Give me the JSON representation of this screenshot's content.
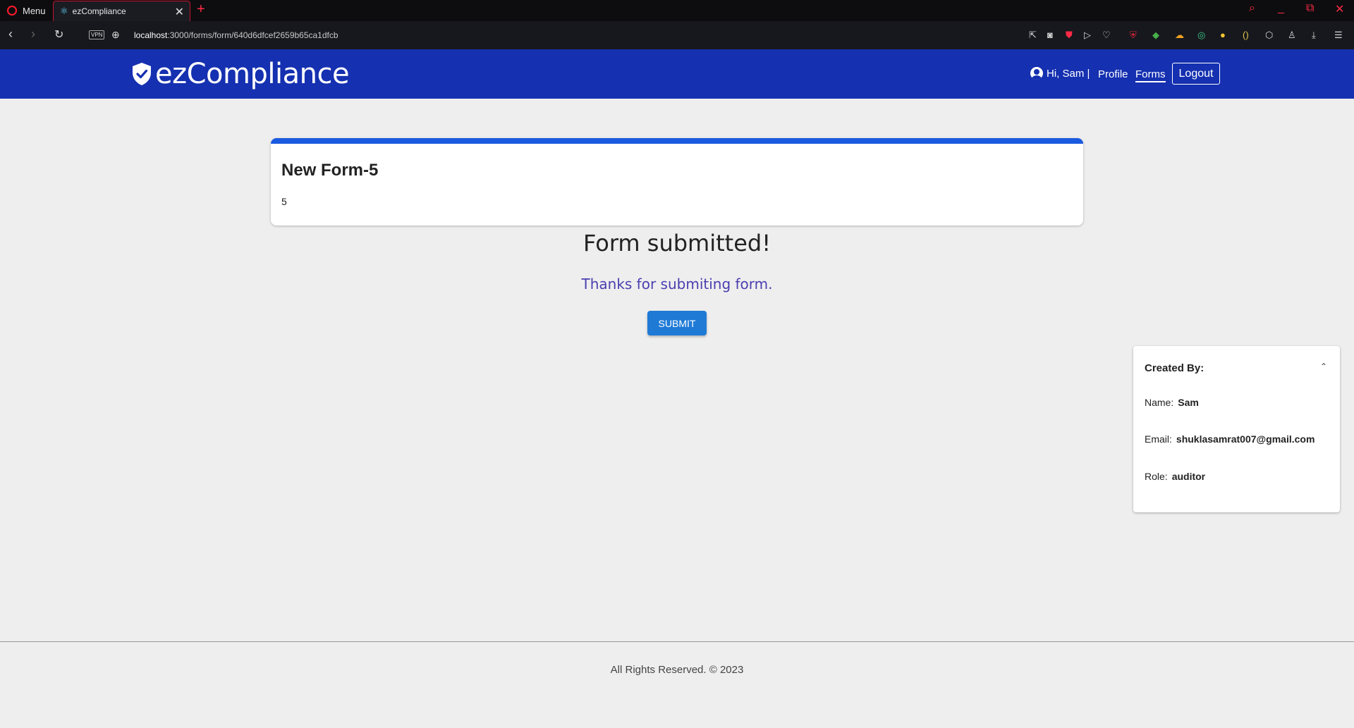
{
  "browser": {
    "menu_label": "Menu",
    "tab_title": "ezCompliance",
    "url_host": "localhost",
    "url_path": ":3000/forms/form/640d6dfcef2659b65ca1dfcb",
    "vpn_label": "VPN"
  },
  "header": {
    "logo_text": "ezCompliance",
    "greeting": "Hi, Sam |",
    "nav_profile": "Profile",
    "nav_forms": "Forms",
    "logout_label": "Logout"
  },
  "form": {
    "title": "New Form-5",
    "description": "5",
    "submitted_title": "Form submitted!",
    "thanks_message": "Thanks for submiting form.",
    "submit_label": "SUBMIT"
  },
  "creator": {
    "heading": "Created By:",
    "name_label": "Name:",
    "name_value": "Sam",
    "email_label": "Email:",
    "email_value": "shuklasamrat007@gmail.com",
    "role_label": "Role:",
    "role_value": "auditor"
  },
  "footer": {
    "text": "All Rights Reserved. © 2023"
  },
  "colors": {
    "header_bg": "#1530b0",
    "card_accent": "#1a5ae0",
    "submit_button": "#1f7ad6",
    "thanks_text": "#4a3fb0"
  }
}
